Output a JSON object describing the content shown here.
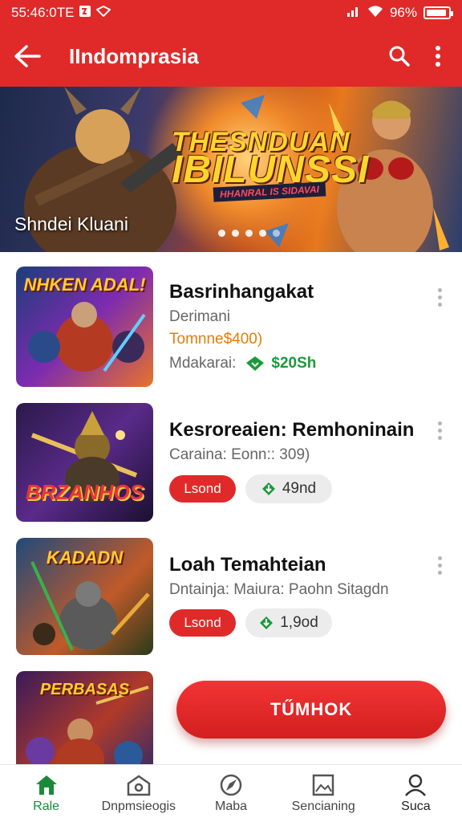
{
  "status_bar": {
    "time": "55:46:0TE",
    "battery": "96%"
  },
  "app_bar": {
    "title": "IIndomprasia"
  },
  "hero": {
    "title_line1": "THESNDUAN",
    "title_line2": "IBILUNSSI",
    "tagline": "HHANRAL IS SIDAVAI",
    "caption": "Shndei Kluani",
    "slide_count": 5,
    "active_slide": 1
  },
  "items": [
    {
      "thumb_text": "NHKEN ADAL!",
      "title": "Basrinhangakat",
      "subtitle": "Derimani",
      "price": "Tomnne$400)",
      "meta_label": "Mdakarai:",
      "meta_value": "$20Sh"
    },
    {
      "thumb_text": "BRZANHOS",
      "title": "Kesroreaien: Remhoninain",
      "subtitle": "Caraina: Eonn:: 309)",
      "button_label": "Lsond",
      "download_count": "49nd"
    },
    {
      "thumb_text": "KADADN",
      "title": "Loah Temahteian",
      "subtitle": "Dntainja: Maiura: Paohn Sitagdn",
      "button_label": "Lsond",
      "download_count": "1,9od"
    },
    {
      "thumb_text": "PERBASAS"
    }
  ],
  "cta": {
    "label": "TŰMHOK"
  },
  "bottom_nav": [
    {
      "label": "Rale",
      "icon": "home-icon",
      "active": true
    },
    {
      "label": "Dnpmsieogis",
      "icon": "store-icon",
      "active": false
    },
    {
      "label": "Maba",
      "icon": "compass-icon",
      "active": false
    },
    {
      "label": "Sencianing",
      "icon": "gallery-icon",
      "active": false
    },
    {
      "label": "Suca",
      "icon": "profile-icon",
      "active": false
    }
  ],
  "colors": {
    "primary": "#e02a2a",
    "price": "#e07e0a",
    "download": "#1a9a3a",
    "nav_active": "#1a8a3a"
  }
}
